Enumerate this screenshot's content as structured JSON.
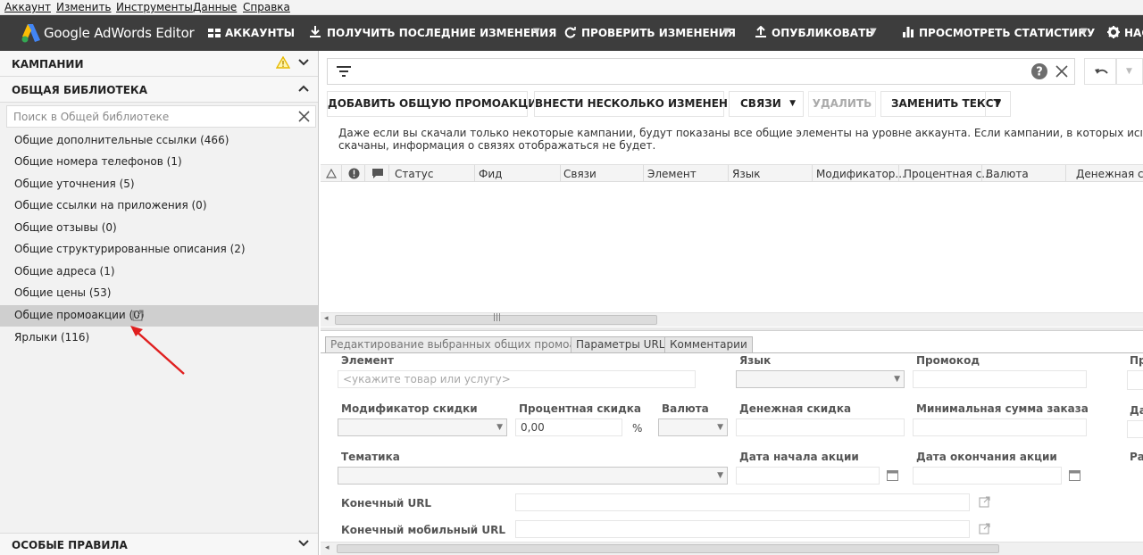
{
  "menu": [
    "Аккаунт",
    "Изменить",
    "Инструменты",
    "Данные",
    "Справка"
  ],
  "toolbar": {
    "brand": "Google AdWords Editor",
    "accounts": "АККАУНТЫ",
    "get_changes": "ПОЛУЧИТЬ ПОСЛЕДНИЕ ИЗМЕНЕНИЯ",
    "check_changes": "ПРОВЕРИТЬ ИЗМЕНЕНИЯ",
    "publish": "ОПУБЛИКОВАТЬ",
    "stats": "ПРОСМОТРЕТЬ СТАТИСТИКУ",
    "settings": "НАС"
  },
  "left": {
    "campaigns": "КАМПАНИИ",
    "shared_library": "ОБЩАЯ БИБЛИОТЕКА",
    "search_placeholder": "Поиск в Общей библиотеке",
    "items": [
      "Общие дополнительные ссылки (466)",
      "Общие номера телефонов (1)",
      "Общие уточнения (5)",
      "Общие ссылки на приложения (0)",
      "Общие отзывы (0)",
      "Общие структурированные описания (2)",
      "Общие адреса (1)",
      "Общие цены (53)",
      "Общие промоакции (0)",
      "Ярлыки (116)"
    ],
    "special_rules": "ОСОБЫЕ ПРАВИЛА"
  },
  "actions": {
    "add_promo": "ДОБАВИТЬ ОБЩУЮ ПРОМОАКЦИЮ",
    "multi_changes": "ВНЕСТИ НЕСКОЛЬКО ИЗМЕНЕНИЙ",
    "links": "СВЯЗИ",
    "delete": "УДАЛИТЬ",
    "replace_text": "ЗАМЕНИТЬ ТЕКСТ"
  },
  "info": {
    "line1": "Даже если вы скачали только некоторые кампании, будут показаны все общие элементы на уровне аккаунта. Если кампании, в которых используются общие элемен",
    "line2": "скачаны, информация о связях отображаться не будет."
  },
  "grid": {
    "columns": [
      "Статус",
      "Фид",
      "Связи",
      "Элемент",
      "Язык",
      "Модификатор...",
      "Процентная с...",
      "Валюта",
      "Денежная ск..."
    ]
  },
  "tabs": [
    "Редактирование выбранных общих промоакций",
    "Параметры URL",
    "Комментарии"
  ],
  "editor": {
    "element_label": "Элемент",
    "element_placeholder": "<укажите товар или услугу>",
    "language_label": "Язык",
    "promocode_label": "Промокод",
    "cut3": "Пр",
    "discount_mod_label": "Модификатор скидки",
    "percent_label": "Процентная скидка",
    "percent_value": "0,00",
    "percent_sign": "%",
    "currency_label": "Валюта",
    "money_label": "Денежная скидка",
    "min_order_label": "Минимальная сумма заказа",
    "cut2": "Да",
    "theme_label": "Тематика",
    "start_label": "Дата начала акции",
    "end_label": "Дата окончания акции",
    "cut1": "Ра",
    "final_url_label": "Конечный URL",
    "final_mobile_label": "Конечный мобильный URL"
  }
}
